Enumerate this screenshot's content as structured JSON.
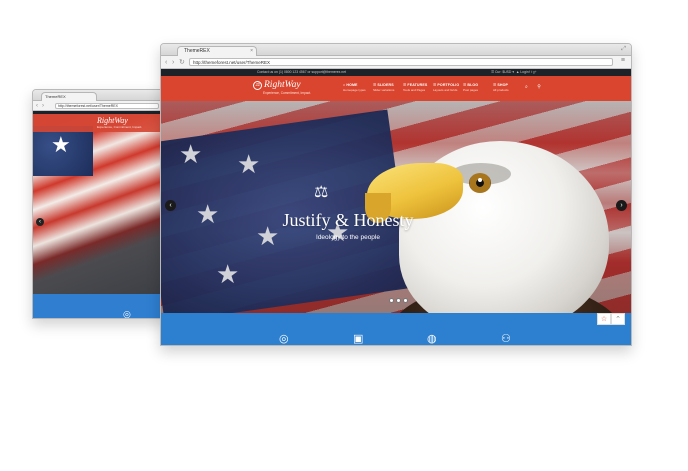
{
  "back_window": {
    "tab_title": "ThemeREX",
    "url": "http://themeforest.net/user/ThemeREX",
    "logo": "RightWay",
    "tagline": "Experience, Commitment, Impact.",
    "prev_glyph": "‹",
    "star_glyph": "★",
    "feature_icon": "◎"
  },
  "front_window": {
    "tab_title": "ThemeREX",
    "tab_close": "×",
    "window_control": "⤢",
    "url": "http://themeforest.net/user/ThemeREX",
    "nav_back": "‹",
    "nav_forward": "›",
    "nav_reload": "↻",
    "menu_glyph": "≡",
    "topbar": {
      "contact": "Contact us on (1) 0800 123 4567 or support@themerex.net",
      "lang": "☰ Cur: $USD ▾",
      "login": "▲ Login",
      "social": "f t g+"
    },
    "header": {
      "logo": "RightWay",
      "logo_mark": "⚖",
      "tagline": "Experience, Commitment, Impact.",
      "nav": [
        {
          "title": "⌂ HOME",
          "sub": "Homepage types"
        },
        {
          "title": "☰ SLIDERS",
          "sub": "Slider variations"
        },
        {
          "title": "☰ FEATURES",
          "sub": "Tools and Pages"
        },
        {
          "title": "☰ PORTFOLIO",
          "sub": "Layouts and Grids"
        },
        {
          "title": "☰ BLOG",
          "sub": "Post pages"
        },
        {
          "title": "☰ SHOP",
          "sub": "All products"
        }
      ],
      "icons": "⌕ ⚲"
    },
    "hero": {
      "icon": "⚖",
      "headline": "Justify & Honesty",
      "subline": "Ideology to the people",
      "prev": "‹",
      "next": "›",
      "star_glyph": "★"
    },
    "features": {
      "icons": [
        "◎",
        "▣",
        "◍",
        "⚇"
      ]
    },
    "corner_buttons": [
      "☆",
      "⌃"
    ]
  }
}
